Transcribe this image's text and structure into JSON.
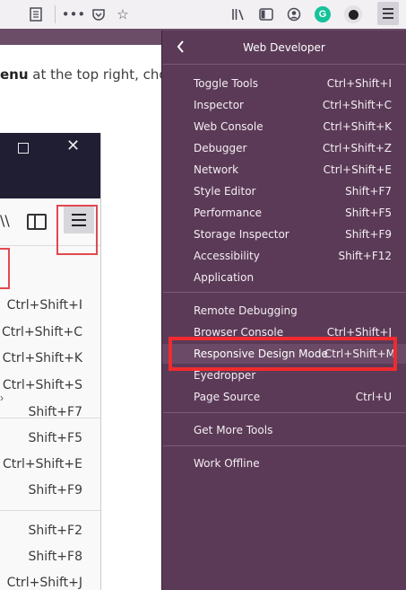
{
  "toolbar": {
    "icons": [
      "reader-view-icon",
      "more-icon",
      "pocket-icon",
      "bookmark-star-icon",
      "library-icon",
      "sidebar-icon",
      "account-icon",
      "grammarly-icon",
      "extension-icon",
      "hamburger-menu-icon"
    ],
    "grammarly_letter": "G"
  },
  "article": {
    "bold_text": "enu",
    "rest_text": " at the top right, cho"
  },
  "embedded": {
    "shortcuts_top": [
      "Ctrl+Shift+I",
      "Ctrl+Shift+C",
      "Ctrl+Shift+K",
      "Ctrl+Shift+S",
      "Shift+F7",
      "Shift+F5",
      "Ctrl+Shift+E",
      "Shift+F9"
    ],
    "shortcuts_bottom": [
      "Shift+F2",
      "Shift+F8",
      "Ctrl+Shift+J"
    ]
  },
  "panel": {
    "title": "Web Developer",
    "group1": [
      {
        "label": "Toggle Tools",
        "shortcut": "Ctrl+Shift+I"
      },
      {
        "label": "Inspector",
        "shortcut": "Ctrl+Shift+C"
      },
      {
        "label": "Web Console",
        "shortcut": "Ctrl+Shift+K"
      },
      {
        "label": "Debugger",
        "shortcut": "Ctrl+Shift+Z"
      },
      {
        "label": "Network",
        "shortcut": "Ctrl+Shift+E"
      },
      {
        "label": "Style Editor",
        "shortcut": "Shift+F7"
      },
      {
        "label": "Performance",
        "shortcut": "Shift+F5"
      },
      {
        "label": "Storage Inspector",
        "shortcut": "Shift+F9"
      },
      {
        "label": "Accessibility",
        "shortcut": "Shift+F12"
      },
      {
        "label": "Application",
        "shortcut": ""
      }
    ],
    "group2": [
      {
        "label": "Remote Debugging",
        "shortcut": ""
      },
      {
        "label": "Browser Console",
        "shortcut": "Ctrl+Shift+J"
      },
      {
        "label": "Responsive Design Mode",
        "shortcut": "Ctrl+Shift+M"
      },
      {
        "label": "Eyedropper",
        "shortcut": ""
      },
      {
        "label": "Page Source",
        "shortcut": "Ctrl+U"
      }
    ],
    "group3": [
      {
        "label": "Get More Tools",
        "shortcut": ""
      }
    ],
    "group4": [
      {
        "label": "Work Offline",
        "shortcut": ""
      }
    ]
  },
  "colors": {
    "panel_bg": "#5b3a57",
    "highlight_border": "#ef2b2f",
    "toolbar_bg": "#f2f0f3"
  }
}
